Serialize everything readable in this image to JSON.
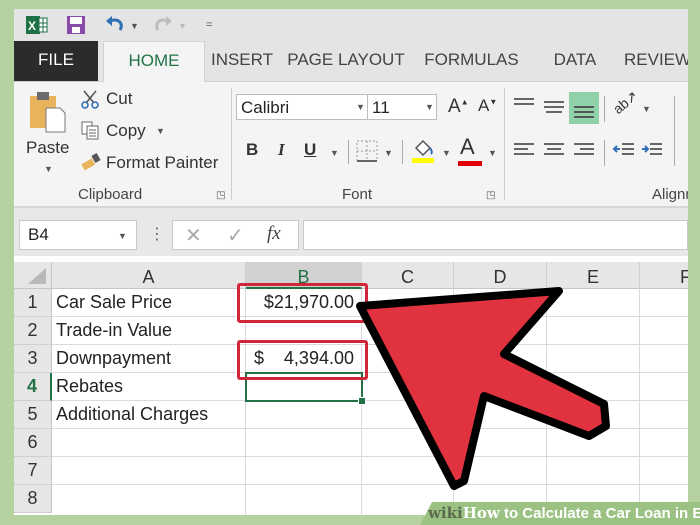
{
  "quick_access": {
    "icons": [
      "excel-logo-icon",
      "save-icon",
      "undo-icon",
      "redo-icon",
      "customize-icon"
    ]
  },
  "tabs": [
    {
      "label": "FILE"
    },
    {
      "label": "HOME",
      "active": true
    },
    {
      "label": "INSERT"
    },
    {
      "label": "PAGE LAYOUT"
    },
    {
      "label": "FORMULAS"
    },
    {
      "label": "DATA"
    },
    {
      "label": "REVIEW"
    }
  ],
  "ribbon": {
    "clipboard": {
      "paste": "Paste",
      "cut": "Cut",
      "copy": "Copy",
      "format_painter": "Format Painter",
      "label": "Clipboard"
    },
    "font": {
      "font_name": "Calibri",
      "font_size": "11",
      "bold": "B",
      "italic": "I",
      "underline": "U",
      "font_color_glyph": "A",
      "grow": "A",
      "shrink": "A",
      "label": "Font",
      "highlight_color": "#ffff00",
      "font_color": "#e00000"
    },
    "alignment": {
      "label": "Alignment"
    }
  },
  "formula_bar": {
    "name_box": "B4",
    "cancel": "✕",
    "enter": "✓",
    "fx": "fx",
    "formula": ""
  },
  "grid": {
    "columns": [
      "A",
      "B",
      "C",
      "D",
      "E",
      "F"
    ],
    "selected_column": "B",
    "rows": [
      "1",
      "2",
      "3",
      "4",
      "5",
      "6",
      "7",
      "8"
    ],
    "selected_row": "4",
    "cells": {
      "A1": "Car Sale Price",
      "A2": "Trade-in Value",
      "A3": "Downpayment",
      "A4": "Rebates",
      "A5": "Additional Charges",
      "B1": "$21,970.00",
      "B3_symbol": "$",
      "B3_value": "4,394.00"
    },
    "selected_cell": "B4"
  },
  "annotations": {
    "highlight_color": "#d0263a",
    "arrow_color": "#e0323f"
  },
  "watermark": {
    "wiki": "wiki",
    "how": "How",
    "rest": " to Calculate a Car Loan in Excel"
  }
}
